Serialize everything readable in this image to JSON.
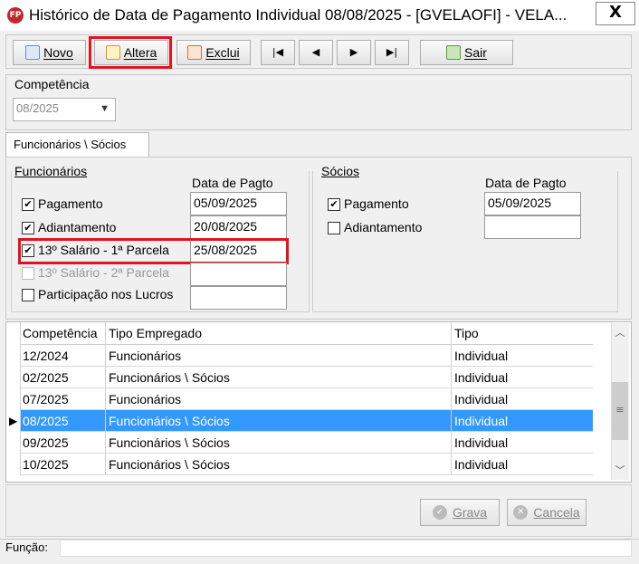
{
  "window": {
    "title": "Histórico de Data de Pagamento Individual  08/08/2025 - [GVELAOFI] - VELA...",
    "app_icon": "FP",
    "close": "X"
  },
  "toolbar": {
    "novo": "Novo",
    "altera": "Altera",
    "exclui": "Exclui",
    "first": "|◀",
    "prev": "◀",
    "next": "▶",
    "last": "▶|",
    "sair": "Sair"
  },
  "competencia": {
    "label": "Competência",
    "value": "08/2025"
  },
  "tab": {
    "label": "Funcionários \\ Sócios"
  },
  "funcionarios": {
    "label": "Funcionários",
    "date_header": "Data de Pagto",
    "items": [
      {
        "label": "Pagamento",
        "checked": "✔",
        "date": "05/09/2025"
      },
      {
        "label": "Adiantamento",
        "checked": "✔",
        "date": "20/08/2025"
      },
      {
        "label": "13º Salário - 1ª Parcela",
        "checked": "✔",
        "date": "25/08/2025"
      },
      {
        "label": "13º Salário - 2ª Parcela",
        "checked": "",
        "date": ""
      },
      {
        "label": "Participação nos Lucros",
        "checked": "",
        "date": ""
      }
    ]
  },
  "socios": {
    "label": "Sócios",
    "date_header": "Data de Pagto",
    "items": [
      {
        "label": "Pagamento",
        "checked": "✔",
        "date": "05/09/2025"
      },
      {
        "label": "Adiantamento",
        "checked": "",
        "date": ""
      }
    ]
  },
  "grid": {
    "headers": [
      "Competência",
      "Tipo Empregado",
      "Tipo"
    ],
    "rows": [
      [
        "12/2024",
        "Funcionários",
        "Individual"
      ],
      [
        "02/2025",
        "Funcionários \\ Sócios",
        "Individual"
      ],
      [
        "07/2025",
        "Funcionários",
        "Individual"
      ],
      [
        "08/2025",
        "Funcionários \\ Sócios",
        "Individual"
      ],
      [
        "09/2025",
        "Funcionários \\ Sócios",
        "Individual"
      ],
      [
        "10/2025",
        "Funcionários \\ Sócios",
        "Individual"
      ]
    ],
    "selected_marker": "▶"
  },
  "footer": {
    "grava": "Grava",
    "cancela": "Cancela",
    "funcao_label": "Função:"
  },
  "colors": {
    "highlight": "#e0141e",
    "selection": "#3399ff"
  }
}
